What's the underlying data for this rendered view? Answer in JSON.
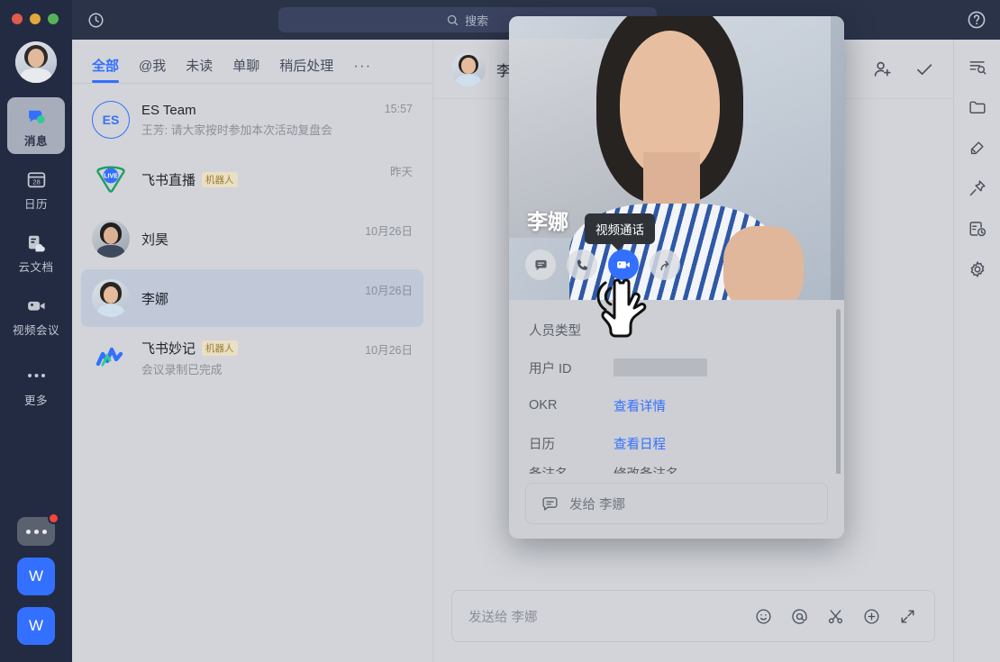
{
  "window": {
    "traffic_lights": [
      "close",
      "minimize",
      "maximize"
    ],
    "accent": "#3370ff",
    "rail_bg": "#222b42",
    "surface_bg": "#d2d4d9"
  },
  "topbar": {
    "history_icon": "history-clock-icon",
    "search": {
      "icon": "search-icon",
      "placeholder": "搜索"
    },
    "help_icon": "help-circle-icon"
  },
  "sidebar": {
    "avatar": "user-avatar",
    "items": [
      {
        "label": "消息",
        "icon": "messages-icon",
        "active": true
      },
      {
        "label": "日历",
        "icon": "calendar-icon",
        "badge": "28",
        "active": false
      },
      {
        "label": "云文档",
        "icon": "cloud-docs-icon",
        "active": false
      },
      {
        "label": "视频会议",
        "icon": "video-meeting-icon",
        "active": false
      },
      {
        "label": "更多",
        "icon": "more-dots-icon",
        "active": false
      }
    ],
    "bottom": {
      "more_apps": "more-apps-button",
      "apps": [
        {
          "label": "W",
          "name": "workspace-app-1"
        },
        {
          "label": "W",
          "name": "workspace-app-2"
        }
      ]
    }
  },
  "chatlist": {
    "tabs": [
      {
        "label": "全部",
        "active": true
      },
      {
        "label": "@我",
        "active": false
      },
      {
        "label": "未读",
        "active": false
      },
      {
        "label": "单聊",
        "active": false
      },
      {
        "label": "稍后处理",
        "active": false
      },
      {
        "label": "···",
        "active": false
      }
    ],
    "rows": [
      {
        "name": "ES Team",
        "avatar_text": "ES",
        "avatar_kind": "initials",
        "preview": "王芳: 请大家按时参加本次活动复盘会",
        "time": "15:57",
        "tag": "",
        "selected": false
      },
      {
        "name": "飞书直播",
        "avatar_text": "LIVE",
        "avatar_kind": "live",
        "preview": "",
        "time": "昨天",
        "tag": "机器人",
        "selected": false
      },
      {
        "name": "刘昊",
        "avatar_text": "",
        "avatar_kind": "photo-male",
        "preview": "",
        "time": "10月26日",
        "tag": "",
        "selected": false
      },
      {
        "name": "李娜",
        "avatar_text": "",
        "avatar_kind": "photo-female",
        "preview": "",
        "time": "10月26日",
        "tag": "",
        "selected": true
      },
      {
        "name": "飞书妙记",
        "avatar_text": "",
        "avatar_kind": "minutes",
        "preview": "会议录制已完成",
        "time": "10月26日",
        "tag": "机器人",
        "selected": false
      }
    ]
  },
  "conversation": {
    "header": {
      "avatar": "contact-avatar",
      "title": "李娜",
      "add_member_icon": "add-person-icon",
      "todo_icon": "check-icon"
    },
    "composer": {
      "placeholder": "发送给 李娜",
      "icons": [
        "emoji-icon",
        "mention-icon",
        "screenshot-scissors-icon",
        "add-plus-icon",
        "expand-icon"
      ]
    }
  },
  "right_rail": {
    "icons": [
      "search-in-chat-icon",
      "folder-icon",
      "edit-pen-icon",
      "pin-icon",
      "schedule-history-icon",
      "settings-gear-icon"
    ]
  },
  "profile_card": {
    "name": "李娜",
    "photo": "contact-large-photo",
    "actions": [
      {
        "name": "message-action",
        "icon": "chat-bubble-icon",
        "highlighted": false
      },
      {
        "name": "voice-call-action",
        "icon": "phone-icon",
        "highlighted": false
      },
      {
        "name": "video-call-action",
        "icon": "video-camera-icon",
        "highlighted": true
      },
      {
        "name": "share-contact-action",
        "icon": "share-arrow-icon",
        "highlighted": false
      }
    ],
    "tooltip": "视频通话",
    "fields": [
      {
        "key": "人员类型",
        "value": "",
        "type": "text"
      },
      {
        "key": "用户 ID",
        "value": "",
        "type": "masked"
      },
      {
        "key": "OKR",
        "value": "查看详情",
        "type": "link"
      },
      {
        "key": "日历",
        "value": "查看日程",
        "type": "link"
      },
      {
        "key": "备注名",
        "value": "修改备注名",
        "type": "text"
      }
    ],
    "send_placeholder": "发给 李娜",
    "send_icon": "chat-bubble-icon"
  }
}
